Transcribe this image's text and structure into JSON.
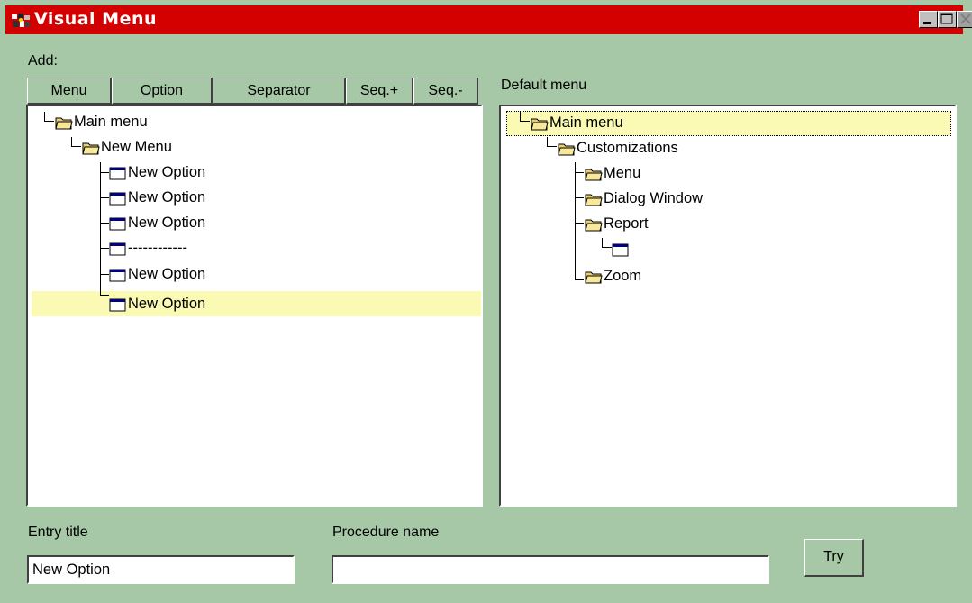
{
  "window": {
    "title": "Visual Menu",
    "controls": [
      "minimize",
      "maximize",
      "close"
    ]
  },
  "add_panel": {
    "label": "Add:",
    "buttons": [
      {
        "label": "Menu",
        "mnemonic": "M"
      },
      {
        "label": "Option",
        "mnemonic": "O"
      },
      {
        "label": "Separator",
        "mnemonic": "S"
      },
      {
        "label": "Seq.+",
        "mnemonic": "S"
      },
      {
        "label": "Seq.-",
        "mnemonic": "S"
      }
    ],
    "tree": [
      {
        "label": "Main menu",
        "icon": "folder-icon",
        "level": 0
      },
      {
        "label": "New Menu",
        "icon": "folder-icon",
        "level": 1
      },
      {
        "label": "New Option",
        "icon": "window-icon",
        "level": 2
      },
      {
        "label": "New Option",
        "icon": "window-icon",
        "level": 2
      },
      {
        "label": "New Option",
        "icon": "window-icon",
        "level": 2
      },
      {
        "label": "------------",
        "icon": "window-icon",
        "level": 2
      },
      {
        "label": "New Option",
        "icon": "window-icon",
        "level": 2
      },
      {
        "label": "New Option",
        "icon": "window-icon",
        "level": 2,
        "selected": true
      }
    ]
  },
  "default_panel": {
    "label": "Default menu",
    "tree": [
      {
        "label": "Main menu",
        "icon": "folder-icon",
        "level": 0,
        "selected": true
      },
      {
        "label": "Customizations",
        "icon": "folder-icon",
        "level": 1
      },
      {
        "label": "Menu",
        "icon": "folder-icon",
        "level": 2
      },
      {
        "label": "Dialog Window",
        "icon": "folder-icon",
        "level": 2
      },
      {
        "label": "Report",
        "icon": "folder-icon",
        "level": 2
      },
      {
        "label": "",
        "icon": "window-icon",
        "level": 3
      },
      {
        "label": "Zoom",
        "icon": "folder-icon",
        "level": 2
      }
    ]
  },
  "form": {
    "entry_title_label": "Entry title",
    "entry_title_value": "New Option",
    "procedure_name_label": "Procedure name",
    "procedure_name_value": "",
    "try_label": "Try",
    "try_mnemonic": "T"
  },
  "colors": {
    "background": "#a6c8a6",
    "titlebar": "#d40000",
    "selection": "#fafab4"
  }
}
